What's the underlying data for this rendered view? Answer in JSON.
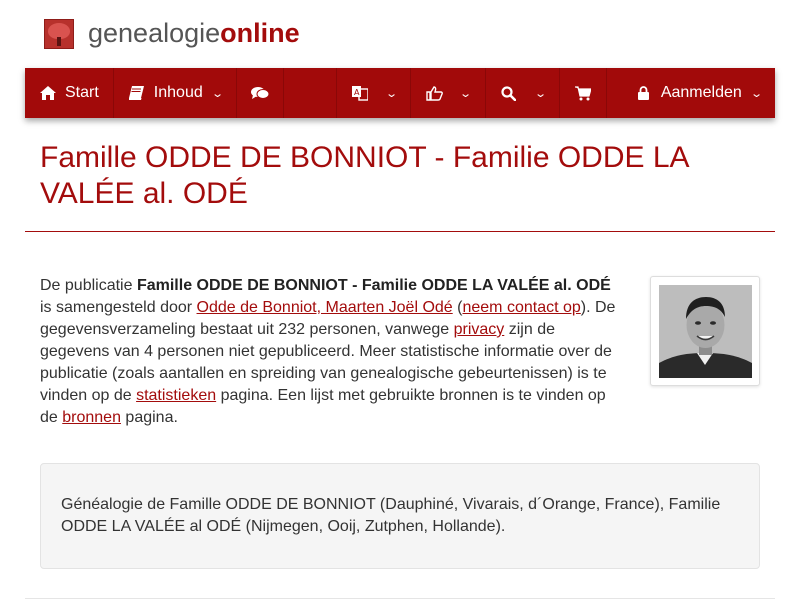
{
  "logo": {
    "text_plain": "genealogie",
    "text_highlight": "online"
  },
  "nav": {
    "start_label": "Start",
    "inhoud_label": "Inhoud",
    "login_label": "Aanmelden",
    "chevron": "⌄"
  },
  "title": "Famille ODDE DE BONNIOT - Familie ODDE LA VALÉE al. ODÉ",
  "intro": {
    "t1": "De publicatie ",
    "pub_name": "Famille ODDE DE BONNIOT - Familie ODDE LA VALÉE al. ODÉ",
    "t2": " is samengesteld door ",
    "author_link": "Odde de Bonniot, Maarten Joël Odé",
    "t3": " (",
    "contact_link": "neem contact op",
    "t4": "). De gegevensverzameling bestaat uit 232 personen, vanwege ",
    "privacy_link": "privacy",
    "t5": " zijn de gegevens van 4 personen niet gepubliceerd. Meer statistische informatie over de publicatie (zoals aantallen en spreiding van genealogische gebeurtenissen) is te vinden op de ",
    "stats_link": "statistieken",
    "t6": " pagina. Een lijst met gebruikte bronnen is te vinden op de ",
    "sources_link": "bronnen",
    "t7": " pagina."
  },
  "description": "Généalogie de Famille ODDE DE BONNIOT (Dauphiné, Vivarais, d´Orange, France), Familie ODDE LA VALÉE al ODÉ (Nijmegen, Ooij, Zutphen, Hollande).",
  "icons": {
    "home": "home-icon",
    "book": "book-icon",
    "chat": "comments-icon",
    "language": "language-icon",
    "thumbs": "thumbs-up-icon",
    "search": "search-icon",
    "cart": "cart-icon",
    "lock": "lock-icon"
  },
  "colors": {
    "brand": "#a20a0a",
    "title": "#a30c0c",
    "text": "#333333"
  }
}
